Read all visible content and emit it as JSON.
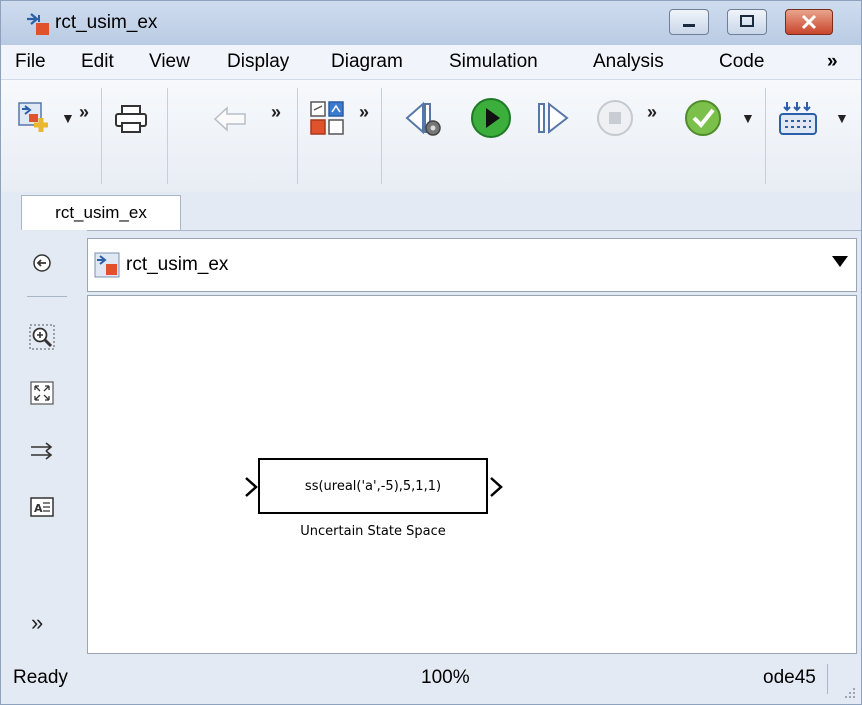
{
  "window": {
    "title": "rct_usim_ex"
  },
  "menu": {
    "items": [
      "File",
      "Edit",
      "View",
      "Display",
      "Diagram",
      "Simulation",
      "Analysis",
      "Code",
      "»"
    ]
  },
  "toolbar": {
    "chevron": "»",
    "icons": [
      "new-model-icon",
      "print-icon",
      "back-icon",
      "library-browser-icon",
      "step-back-icon",
      "run-icon",
      "step-forward-icon",
      "stop-icon",
      "check-icon",
      "build-icon"
    ]
  },
  "tabs": [
    {
      "label": "rct_usim_ex"
    }
  ],
  "address": {
    "text": "rct_usim_ex"
  },
  "palette": {
    "more": "»"
  },
  "block": {
    "expression": "ss(ureal('a',-5),5,1,1)",
    "label": "Uncertain State Space"
  },
  "status": {
    "ready": "Ready",
    "zoom": "100%",
    "solver": "ode45"
  },
  "colors": {
    "run_green": "#3cae3c",
    "title_bar": "#c4d4ea",
    "close_red": "#c8452c"
  }
}
